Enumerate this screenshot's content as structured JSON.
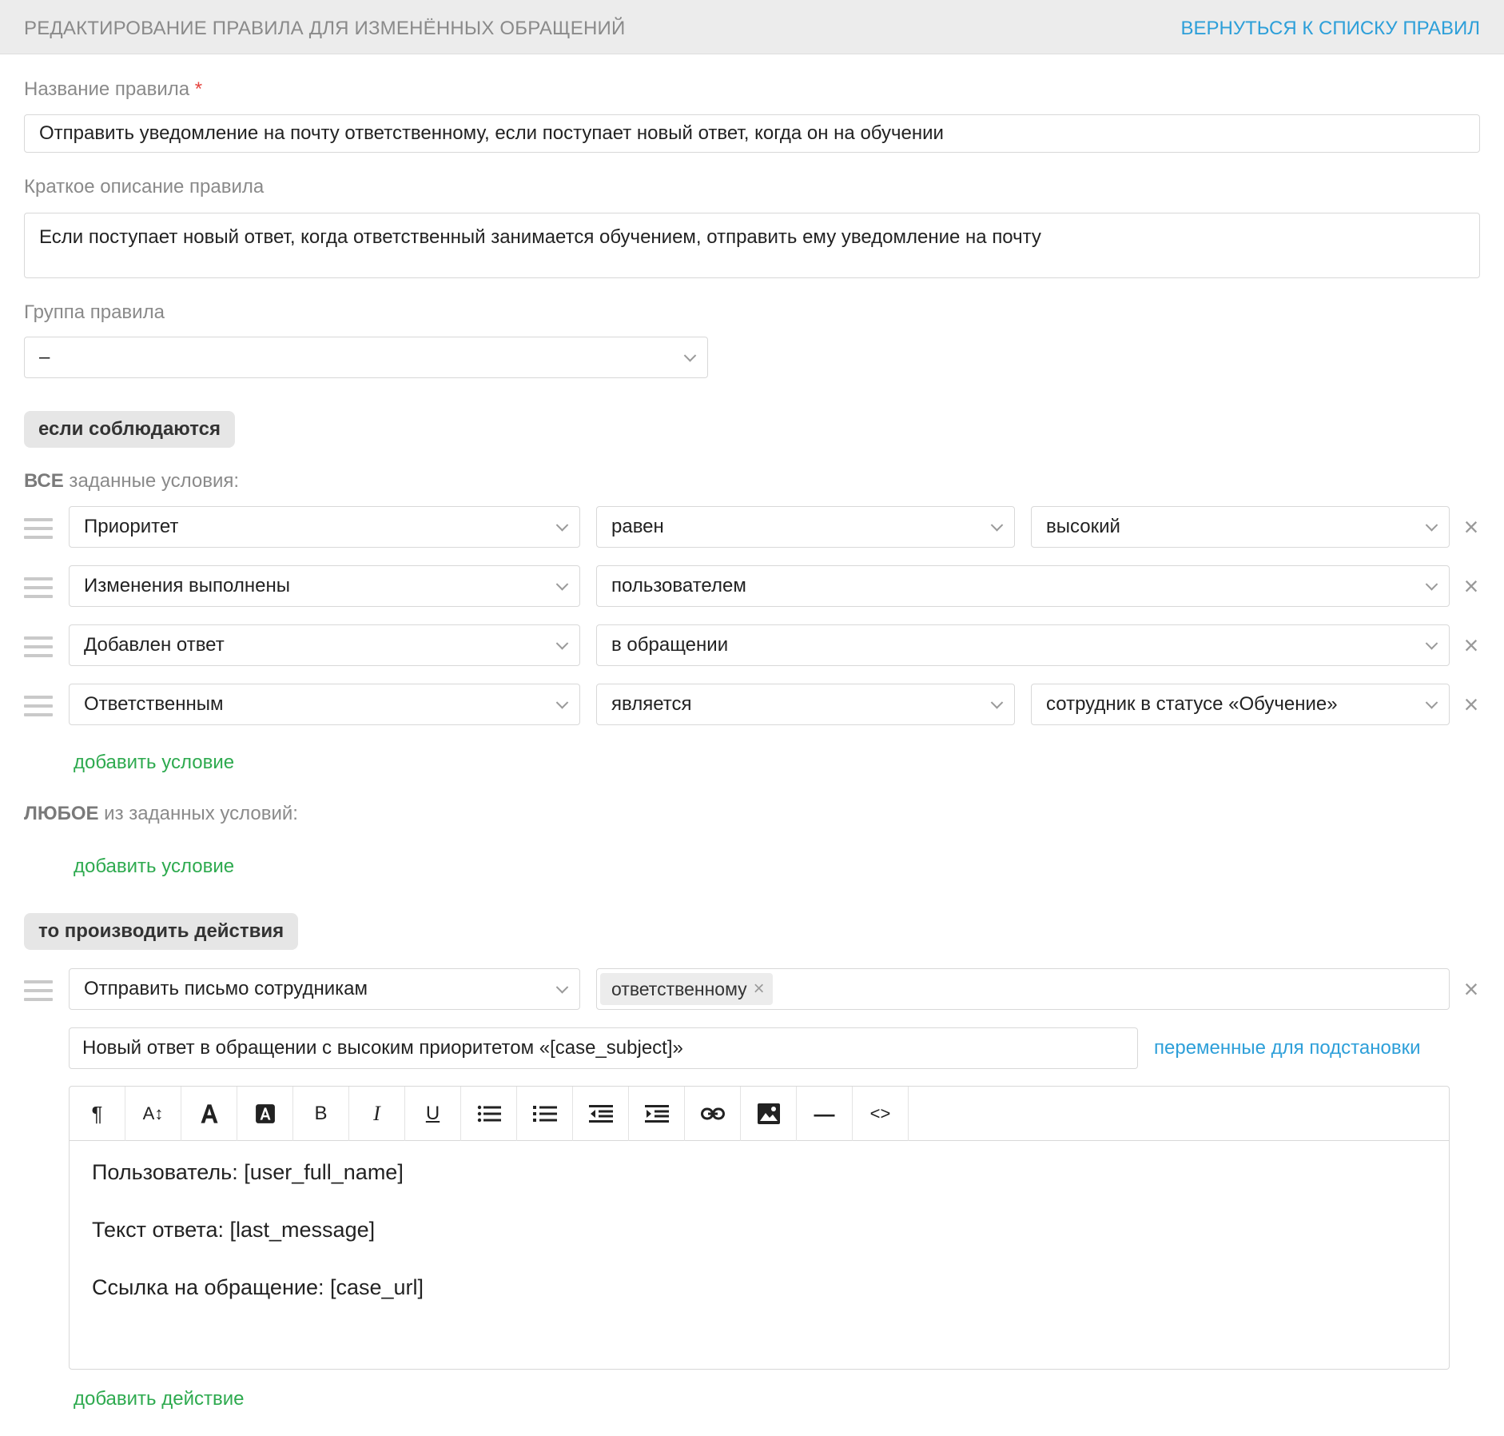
{
  "header": {
    "title": "РЕДАКТИРОВАНИЕ ПРАВИЛА ДЛЯ ИЗМЕНЁННЫХ ОБРАЩЕНИЙ",
    "back_link": "ВЕРНУТЬСЯ К СПИСКУ ПРАВИЛ"
  },
  "form": {
    "name_label": "Название правила",
    "required_mark": "*",
    "name_value": "Отправить уведомление на почту ответственному, если поступает новый ответ, когда он на обучении",
    "desc_label": "Краткое описание правила",
    "desc_value": "Если поступает новый ответ, когда ответственный занимается обучением, отправить ему уведомление на почту",
    "group_label": "Группа правила",
    "group_value": "–"
  },
  "conditions": {
    "if_pill": "если соблюдаются",
    "all_prefix": "ВСЕ",
    "all_suffix": " заданные условия:",
    "all": [
      {
        "field": "Приоритет",
        "operator": "равен",
        "value": "высокий"
      },
      {
        "field": "Изменения выполнены",
        "operator": "пользователем"
      },
      {
        "field": "Добавлен ответ",
        "operator": "в обращении"
      },
      {
        "field": "Ответственным",
        "operator": "является",
        "value": "сотрудник в статусе «Обучение»"
      }
    ],
    "add_condition": "добавить условие",
    "any_prefix": "ЛЮБОЕ",
    "any_suffix": " из заданных условий:"
  },
  "actions": {
    "then_pill": "то производить действия",
    "action_type": "Отправить письмо сотрудникам",
    "recipient_tag": "ответственному",
    "tag_remove": "×",
    "subject": "Новый ответ в обращении с высоким приоритетом «[case_subject]»",
    "variables_link": "переменные для подстановки",
    "body_lines": [
      "Пользователь: [user_full_name]",
      "Текст ответа: [last_message]",
      "Ссылка на обращение: [case_url]"
    ],
    "add_action": "добавить действие"
  },
  "toolbar": {
    "paragraph": "¶",
    "font_size": "A↕",
    "bold": "B",
    "italic": "I",
    "underline": "U",
    "separator": "—",
    "code": "<>",
    "icons": [
      "paragraph-icon",
      "font-size-icon",
      "text-color-icon",
      "background-color-icon",
      "bold-icon",
      "italic-icon",
      "underline-icon",
      "unordered-list-icon",
      "ordered-list-icon",
      "outdent-icon",
      "indent-icon",
      "link-icon",
      "image-icon",
      "horizontal-rule-icon",
      "code-icon"
    ]
  },
  "icons": {
    "remove": "×"
  },
  "colors": {
    "header_bg": "#ececec",
    "link_blue": "#2d9fd9",
    "link_green": "#2eaa4f",
    "required_red": "#e5443f"
  }
}
